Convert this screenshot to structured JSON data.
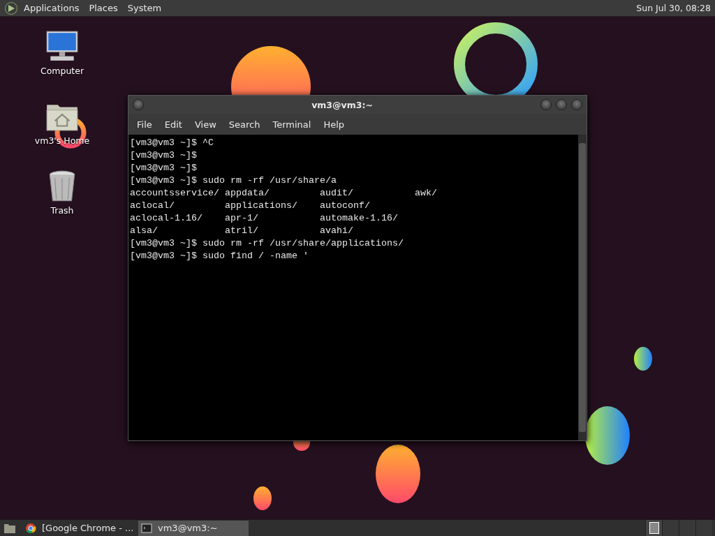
{
  "top_panel": {
    "menus": [
      {
        "label": "Applications"
      },
      {
        "label": "Places"
      },
      {
        "label": "System"
      }
    ],
    "clock": "Sun Jul 30, 08:28"
  },
  "desktop": {
    "icons": [
      {
        "kind": "computer",
        "label": "Computer"
      },
      {
        "kind": "home",
        "label": "vm3's Home"
      },
      {
        "kind": "trash",
        "label": "Trash"
      }
    ]
  },
  "terminal": {
    "title": "vm3@vm3:~",
    "menus": [
      "File",
      "Edit",
      "View",
      "Search",
      "Terminal",
      "Help"
    ],
    "lines": [
      {
        "kind": "text",
        "text": "[vm3@vm3 ~]$ ^C"
      },
      {
        "kind": "text",
        "text": "[vm3@vm3 ~]$"
      },
      {
        "kind": "text",
        "text": "[vm3@vm3 ~]$"
      },
      {
        "kind": "text",
        "text": "[vm3@vm3 ~]$ sudo rm -rf /usr/share/a"
      },
      {
        "kind": "listing",
        "items": [
          "accountsservice/",
          "appdata/",
          "audit/",
          "awk/"
        ]
      },
      {
        "kind": "listing",
        "items": [
          "aclocal/",
          "applications/",
          "autoconf/"
        ]
      },
      {
        "kind": "listing",
        "items": [
          "aclocal-1.16/",
          "apr-1/",
          "automake-1.16/"
        ]
      },
      {
        "kind": "listing",
        "items": [
          "alsa/",
          "atril/",
          "avahi/"
        ]
      },
      {
        "kind": "text",
        "text": "[vm3@vm3 ~]$ sudo rm -rf /usr/share/applications/"
      },
      {
        "kind": "text",
        "text": "[vm3@vm3 ~]$ sudo find / -name '"
      }
    ]
  },
  "taskbar": {
    "tasks": [
      {
        "kind": "browser",
        "label": "[Google Chrome - ...",
        "selected": false
      },
      {
        "kind": "terminal",
        "label": "vm3@vm3:~",
        "selected": true
      }
    ],
    "workspaces": [
      {
        "selected": true
      },
      {
        "selected": false
      },
      {
        "selected": false
      },
      {
        "selected": false
      }
    ]
  }
}
